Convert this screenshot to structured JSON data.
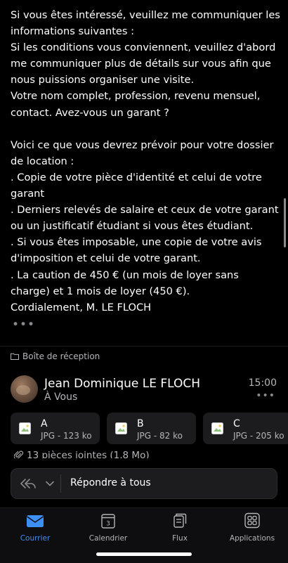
{
  "message": {
    "lines": [
      "Si vous êtes intéressé, veuillez me communiquer les informations suivantes :",
      "Si les conditions vous conviennent, veuillez d'abord me communiquer plus de détails sur vous afin que nous puissions organiser une visite.",
      "Votre nom complet, profession, revenu mensuel, contact. Avez-vous un garant ?",
      "",
      "Voici ce que vous devrez prévoir pour votre dossier de location :",
      ". Copie de votre pièce d'identité et celui de votre garant",
      ". Derniers relevés de salaire et ceux de votre garant ou un justificatif étudiant si vous êtes étudiant.",
      ". Si vous êtes imposable, une copie de votre avis d'imposition et celui de votre garant.",
      ". La caution de 450 € (un mois de loyer sans charge) et 1 mois de loyer (450 €).",
      "Cordialement, M. LE FLOCH"
    ],
    "collapsed_indicator": "•••"
  },
  "folder": {
    "icon": "folder-icon",
    "label": "Boîte de réception"
  },
  "sender": {
    "name": "Jean Dominique LE FLOCH",
    "to": "À Vous",
    "time": "15:00",
    "more": "•••"
  },
  "attachments": [
    {
      "name": "A",
      "meta": "JPG - 123 ko",
      "icon": "image-file-icon"
    },
    {
      "name": "B",
      "meta": "JPG - 82 ko",
      "icon": "image-file-icon"
    },
    {
      "name": "C",
      "meta": "JPG - 205 ko",
      "icon": "image-file-icon"
    }
  ],
  "attachments_summary": "13 pièces jointes (1,8 Mo)",
  "reply": {
    "label": "Répondre à tous"
  },
  "tabs": [
    {
      "label": "Courrier",
      "icon": "mail-icon",
      "active": true
    },
    {
      "label": "Calendrier",
      "icon": "calendar-icon",
      "active": false,
      "day": "3"
    },
    {
      "label": "Flux",
      "icon": "feed-icon",
      "active": false
    },
    {
      "label": "Applications",
      "icon": "apps-icon",
      "active": false
    }
  ],
  "colors": {
    "accent": "#3d8ef5",
    "background": "#000000",
    "card": "#1c1c1e",
    "secondary_text": "#b5b5b9"
  }
}
